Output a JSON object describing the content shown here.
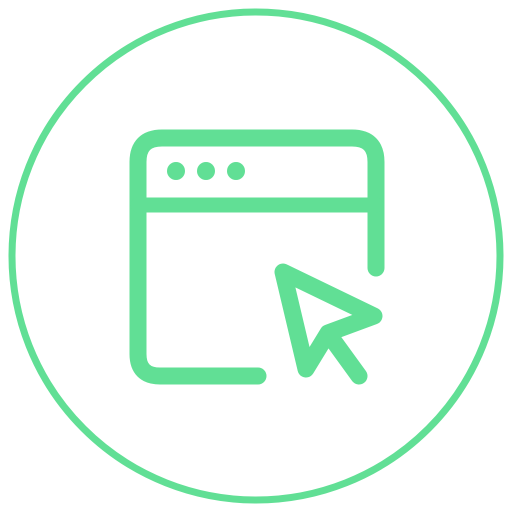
{
  "icon": {
    "name": "browser-window-click-icon",
    "color": "#61DF95",
    "background": "#FFFFFF"
  },
  "elements": {
    "outer_ring": "circle-outline",
    "window": "browser-window",
    "window_dots": "window-controls-dots",
    "cursor": "mouse-pointer-cursor"
  }
}
